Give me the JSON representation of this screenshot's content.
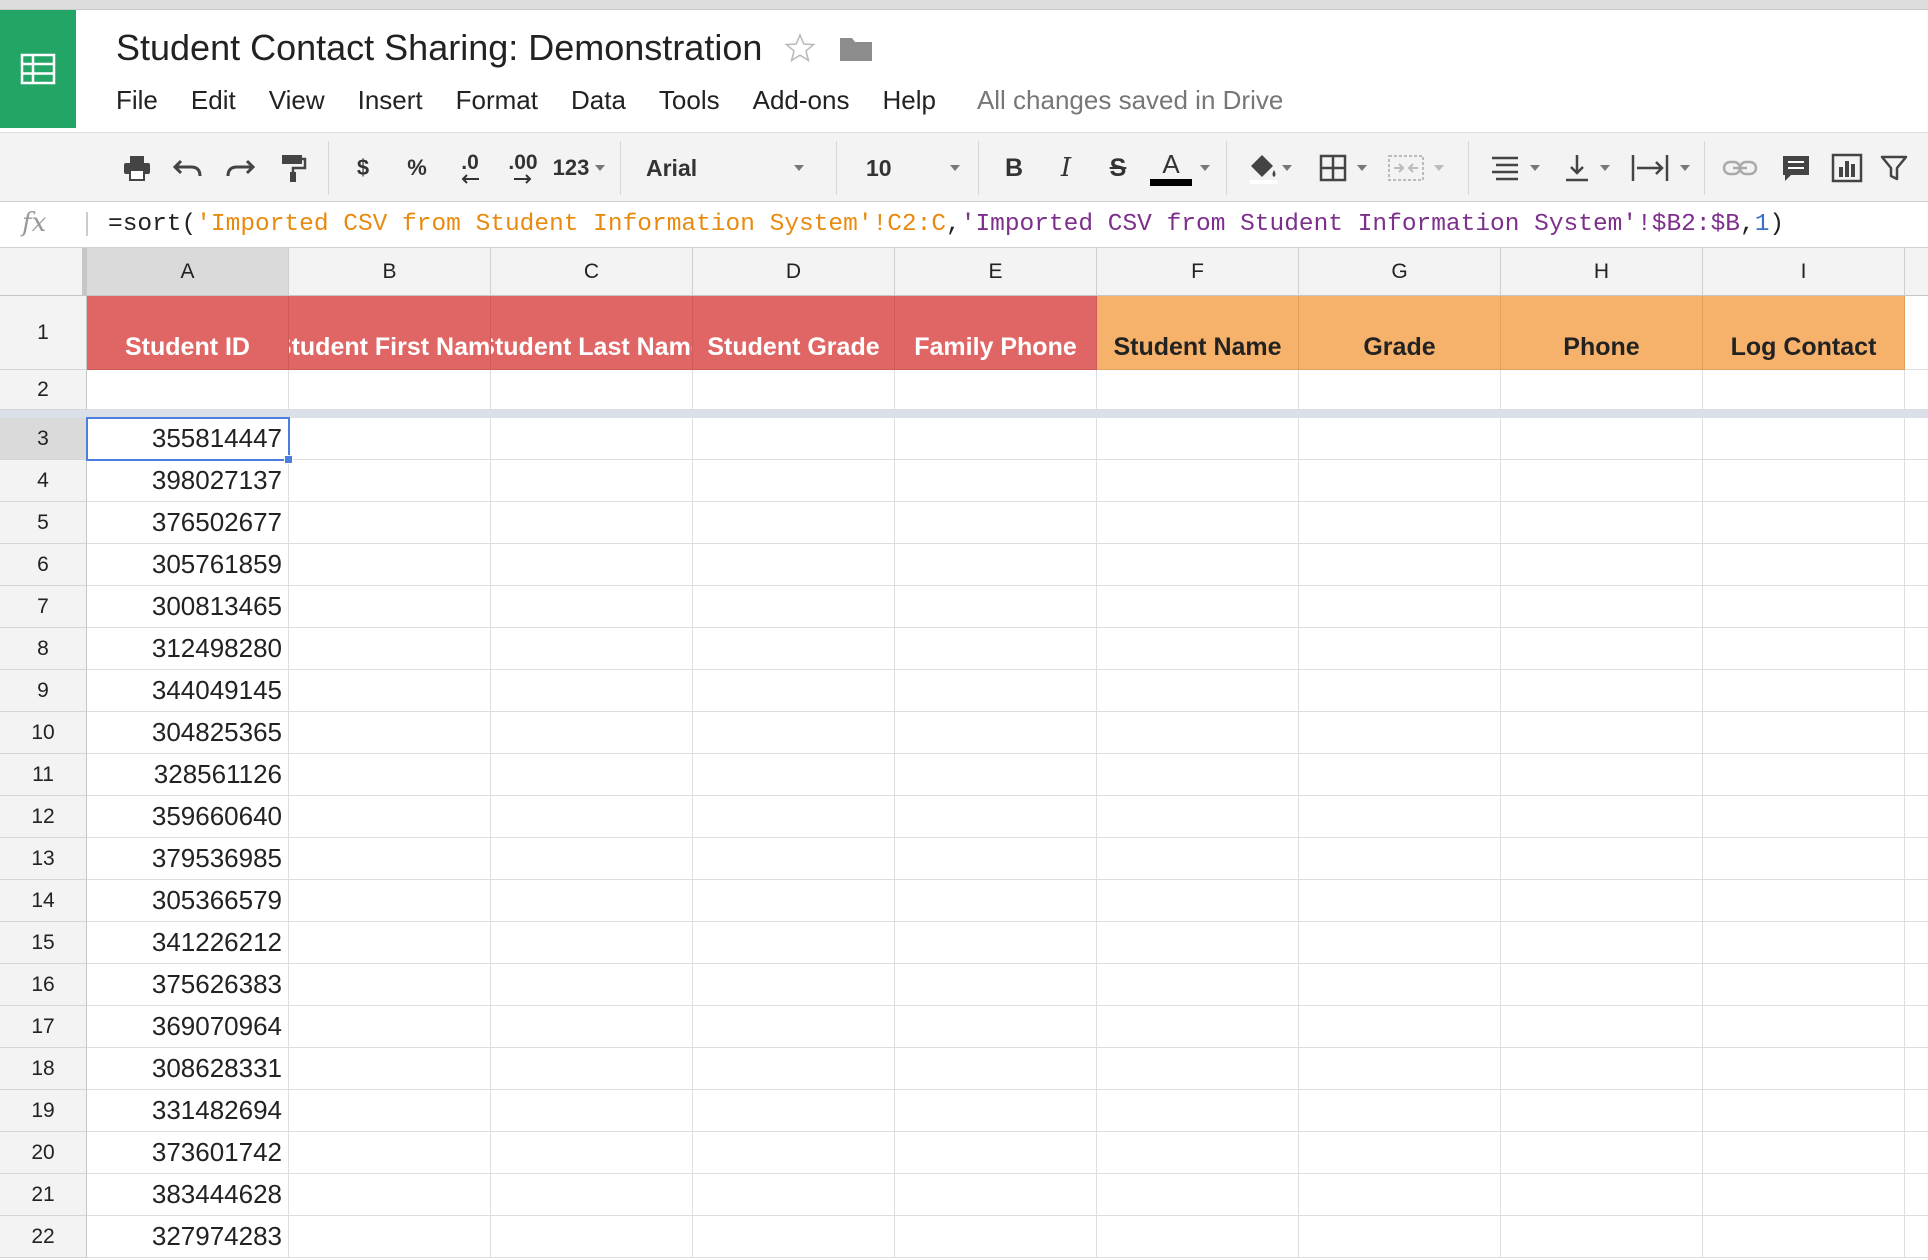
{
  "app": {
    "title": "Student Contact Sharing: Demonstration",
    "save_status": "All changes saved in Drive",
    "accent_color": "#23a566"
  },
  "menu": [
    "File",
    "Edit",
    "View",
    "Insert",
    "Format",
    "Data",
    "Tools",
    "Add-ons",
    "Help"
  ],
  "toolbar": {
    "currency": "$",
    "percent": "%",
    "decrease_decimal": ".0",
    "increase_decimal": ".00",
    "more_formats": "123",
    "font_family": "Arial",
    "font_size": "10",
    "bold": "B",
    "italic": "I",
    "strikethrough": "S",
    "text_color": "A",
    "icons": [
      "print-icon",
      "undo-icon",
      "redo-icon",
      "paint-format-icon",
      "fill-color-icon",
      "borders-icon",
      "merge-cells-icon",
      "align-left-icon",
      "valign-bottom-icon",
      "text-wrap-icon",
      "link-icon",
      "comment-icon",
      "chart-icon",
      "filter-icon"
    ]
  },
  "formula_bar": {
    "label": "fx",
    "parts": [
      {
        "text": "=sort(",
        "color": "#222222"
      },
      {
        "text": "'Imported CSV from Student Information System'!C2:C",
        "color": "#e98a10"
      },
      {
        "text": ",",
        "color": "#222222"
      },
      {
        "text": "'Imported CSV from Student Information System'!$B2:$B",
        "color": "#7d2f8c"
      },
      {
        "text": ",",
        "color": "#222222"
      },
      {
        "text": "1",
        "color": "#3b6fc9"
      },
      {
        "text": ")",
        "color": "#222222"
      }
    ]
  },
  "sheet": {
    "columns": [
      "A",
      "B",
      "C",
      "D",
      "E",
      "F",
      "G",
      "H",
      "I"
    ],
    "header_row": [
      {
        "text": "Student ID",
        "fill": "#e06666"
      },
      {
        "text": "Student First Name",
        "fill": "#e06666"
      },
      {
        "text": "Student Last Name",
        "fill": "#e06666"
      },
      {
        "text": "Student Grade",
        "fill": "#e06666"
      },
      {
        "text": "Family Phone",
        "fill": "#e06666"
      },
      {
        "text": "Student Name",
        "fill": "#f6b26b"
      },
      {
        "text": "Grade",
        "fill": "#f6b26b"
      },
      {
        "text": "Phone",
        "fill": "#f6b26b"
      },
      {
        "text": "Log Contact",
        "fill": "#f6b26b"
      }
    ],
    "row_numbers": [
      "1",
      "2",
      "3",
      "4",
      "5",
      "6",
      "7",
      "8",
      "9",
      "10",
      "11",
      "12",
      "13",
      "14",
      "15",
      "16",
      "17",
      "18",
      "19",
      "20",
      "21",
      "22"
    ],
    "student_ids": [
      "355814447",
      "398027137",
      "376502677",
      "305761859",
      "300813465",
      "312498280",
      "344049145",
      "304825365",
      "328561126",
      "359660640",
      "379536985",
      "305366579",
      "341226212",
      "375626383",
      "369070964",
      "308628331",
      "331482694",
      "373601742",
      "383444628",
      "327974283"
    ],
    "selected_cell": "A3"
  }
}
